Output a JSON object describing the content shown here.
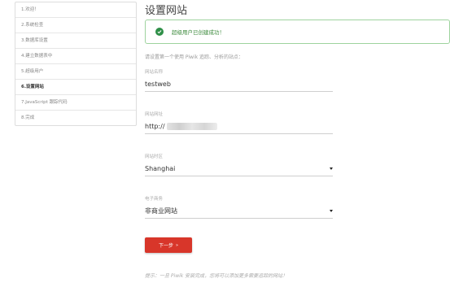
{
  "sidebar": {
    "steps": [
      {
        "label": "1.欢迎！"
      },
      {
        "label": "2.系统检查"
      },
      {
        "label": "3.数据库设置"
      },
      {
        "label": "4.建立数据表中"
      },
      {
        "label": "5.超级用户"
      },
      {
        "label": "6.设置网站"
      },
      {
        "label": "7.JavaScript 跟踪代码"
      },
      {
        "label": "8.完成"
      }
    ],
    "active_index": 5
  },
  "main": {
    "title": "设置网站",
    "alert": {
      "text": "超级用户已创建成功！"
    },
    "intro": "请设置第一个使用 Piwik 追踪、分析的站点：",
    "fields": {
      "site_name": {
        "label": "网站名称",
        "value": "testweb"
      },
      "site_url": {
        "label": "网站网址",
        "value": "http://"
      },
      "timezone": {
        "label": "网站时区",
        "value": "Shanghai"
      },
      "ecommerce": {
        "label": "电子商务",
        "value": "非商业网站"
      }
    },
    "next_button": {
      "label": "下一步",
      "arrow": "»"
    },
    "hint": "提示：一旦 Piwik 安装完成，您将可以添加更多需要追踪的网站！"
  },
  "colors": {
    "accent": "#d8362a",
    "success": "#2f8f48"
  }
}
